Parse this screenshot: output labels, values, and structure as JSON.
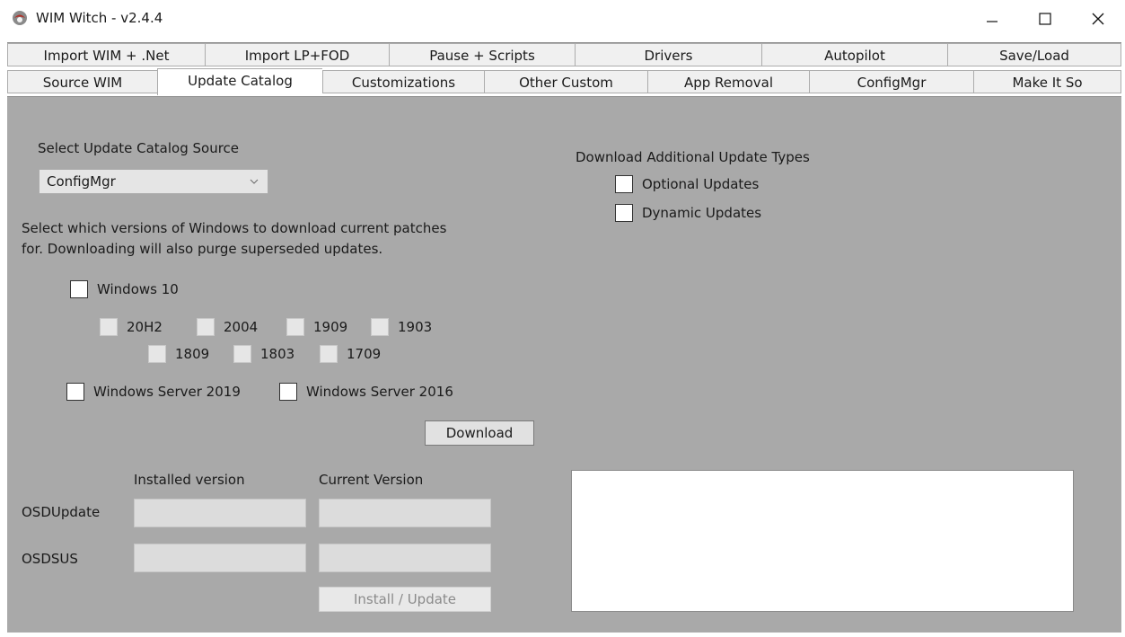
{
  "window": {
    "title": "WIM Witch - v2.4.4"
  },
  "tabs_row1": [
    "Import WIM + .Net",
    "Import LP+FOD",
    "Pause + Scripts",
    "Drivers",
    "Autopilot",
    "Save/Load"
  ],
  "tabs_row2": [
    "Source WIM",
    "Update Catalog",
    "Customizations",
    "Other Custom",
    "App Removal",
    "ConfigMgr",
    "Make It So"
  ],
  "active_tab": "Update Catalog",
  "catalog": {
    "select_label": "Select Update Catalog Source",
    "source_value": "ConfigMgr",
    "description_line1": "Select which versions of Windows to download current patches",
    "description_line2": "for. Downloading will also purge superseded updates.",
    "win10_label": "Windows 10",
    "win10_versions_row1": [
      "20H2",
      "2004",
      "1909",
      "1903"
    ],
    "win10_versions_row2": [
      "1809",
      "1803",
      "1709"
    ],
    "server2019_label": "Windows Server 2019",
    "server2016_label": "Windows Server 2016",
    "download_button": "Download"
  },
  "additional": {
    "heading": "Download Additional Update Types",
    "optional_label": "Optional Updates",
    "dynamic_label": "Dynamic Updates"
  },
  "versions": {
    "installed_header": "Installed version",
    "current_header": "Current Version",
    "osdupdate_label": "OSDUpdate",
    "osdsus_label": "OSDSUS",
    "osdupdate_installed": "",
    "osdupdate_current": "",
    "osdsus_installed": "",
    "osdsus_current": "",
    "install_button": "Install / Update"
  },
  "colors": {
    "panel_bg": "#a9a9a9",
    "tab_bg": "#f0f0f0",
    "accent_icon": "#b22b22"
  }
}
